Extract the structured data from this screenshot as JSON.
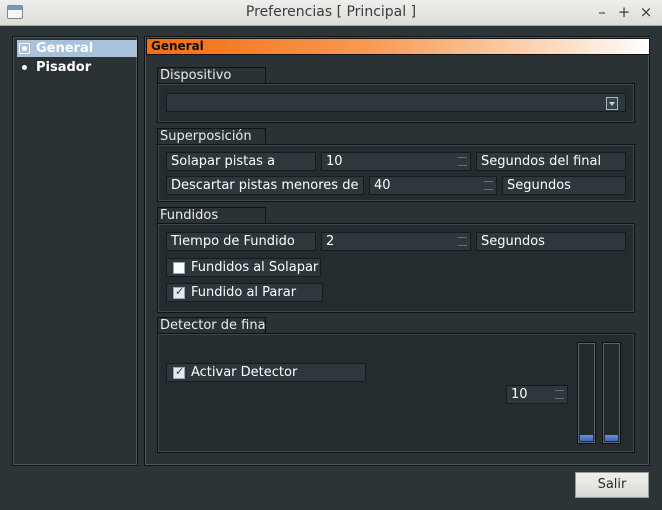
{
  "window": {
    "title": "Preferencias [ Principal ]",
    "minimize_glyph": "–",
    "maximize_glyph": "+",
    "close_glyph": "×"
  },
  "sidebar": {
    "items": [
      {
        "label": "General",
        "selected": true,
        "icon": "gear-icon"
      },
      {
        "label": "Pisador",
        "selected": false,
        "icon": "dot-icon"
      }
    ]
  },
  "header": {
    "title": "General"
  },
  "dispositivo": {
    "label": "Dispositivo",
    "selected_value": ""
  },
  "superposicion": {
    "label": "Superposición",
    "solapar_label": "Solapar pistas a",
    "solapar_value": "10",
    "solapar_unit": "Segundos del final",
    "descartar_label": "Descartar pistas menores de",
    "descartar_value": "40",
    "descartar_unit": "Segundos"
  },
  "fundidos": {
    "label": "Fundidos",
    "tiempo_label": "Tiempo de Fundido",
    "tiempo_value": "2",
    "tiempo_unit": "Segundos",
    "fundidos_solapar_label": "Fundidos al Solapar",
    "fundidos_solapar_checked": false,
    "fundido_parar_label": "Fundido al Parar",
    "fundido_parar_checked": true
  },
  "detector": {
    "label": "Detector de fina",
    "activar_label": "Activar Detector",
    "activar_checked": true,
    "threshold_value": "10",
    "level_left": 0.06,
    "level_right": 0.06
  },
  "footer": {
    "exit_label": "Salir"
  },
  "colors": {
    "accent_orange": "#f36d10",
    "selection_blue": "#a9c2db",
    "meter_blue": "#3f67bf"
  }
}
